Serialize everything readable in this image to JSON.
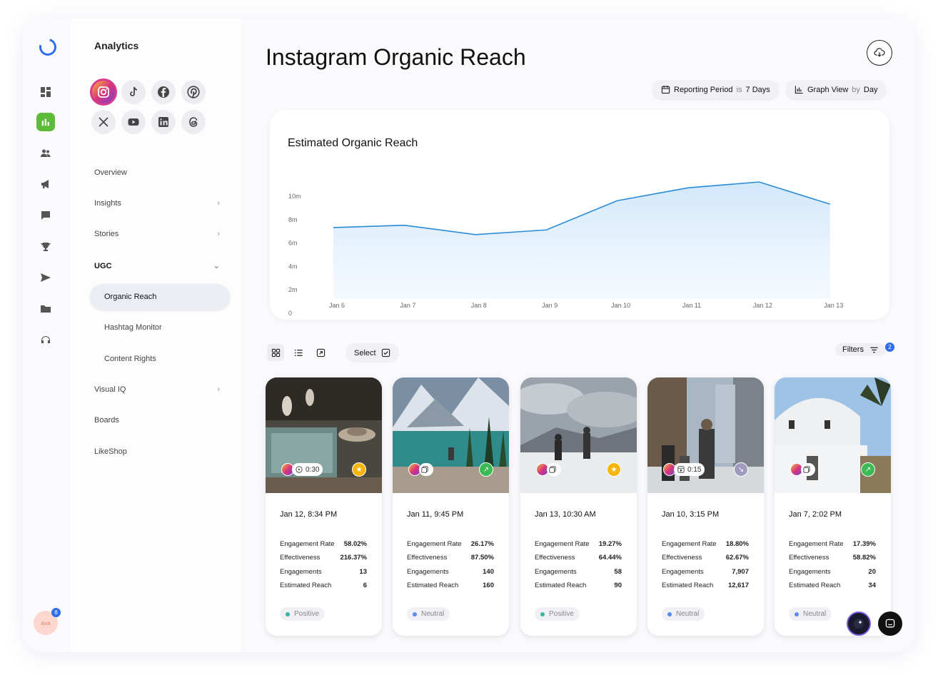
{
  "sidenav": {
    "title": "Analytics",
    "networks": [
      "instagram-icon",
      "tiktok-icon",
      "facebook-icon",
      "pinterest-icon",
      "x-icon",
      "youtube-icon",
      "linkedin-icon",
      "threads-icon"
    ],
    "items": [
      {
        "label": "Overview",
        "chevron": ""
      },
      {
        "label": "Insights",
        "chevron": "›"
      },
      {
        "label": "Stories",
        "chevron": "›"
      },
      {
        "label": "UGC",
        "chevron": "⌄"
      },
      {
        "label": "Organic Reach"
      },
      {
        "label": "Hashtag Monitor"
      },
      {
        "label": "Content Rights"
      },
      {
        "label": "Visual IQ",
        "chevron": "›"
      },
      {
        "label": "Boards"
      },
      {
        "label": "LikeShop"
      }
    ]
  },
  "rail": {
    "avatar_text": "ava",
    "avatar_badge": "8"
  },
  "header": {
    "title": "Instagram Organic Reach",
    "reporting": {
      "label": "Reporting Period",
      "joiner": "is",
      "value": "7 Days"
    },
    "graph": {
      "label": "Graph View",
      "joiner": "by",
      "value": "Day"
    }
  },
  "chart_data": {
    "type": "area",
    "title": "Estimated Organic Reach",
    "x": [
      "Jan 6",
      "Jan 7",
      "Jan 8",
      "Jan 9",
      "Jan 10",
      "Jan 11",
      "Jan 12",
      "Jan 13"
    ],
    "values": [
      6.1,
      6.3,
      5.5,
      5.9,
      8.4,
      9.5,
      10.0,
      8.1
    ],
    "y_ticks": [
      "0",
      "2m",
      "4m",
      "6m",
      "8m",
      "10m"
    ],
    "ylim": [
      0,
      16
    ],
    "grid": false,
    "color": "#2a8bd6"
  },
  "toolbar": {
    "select_label": "Select",
    "filters_label": "Filters",
    "filters_count": "2"
  },
  "metric_labels": [
    "Engagement Rate",
    "Effectiveness",
    "Engagements",
    "Estimated Reach"
  ],
  "posts": [
    {
      "date": "Jan 12, 8:34 PM",
      "duration": "0:30",
      "status": "star",
      "status_color": "#f5b50a",
      "metrics": [
        "58.02%",
        "216.37%",
        "13",
        "6"
      ],
      "sentiment": "Positive",
      "sentiment_color": "#3bb5a0"
    },
    {
      "date": "Jan 11, 9:45 PM",
      "duration": "",
      "status": "arrow-up",
      "status_color": "#3cba54",
      "metrics": [
        "26.17%",
        "87.50%",
        "140",
        "160"
      ],
      "sentiment": "Neutral",
      "sentiment_color": "#5b8de6"
    },
    {
      "date": "Jan 13, 10:30 AM",
      "duration": "",
      "status": "star",
      "status_color": "#f5b50a",
      "metrics": [
        "19.27%",
        "64.44%",
        "58",
        "90"
      ],
      "sentiment": "Positive",
      "sentiment_color": "#3bb5a0"
    },
    {
      "date": "Jan 10, 3:15 PM",
      "duration": "0:15",
      "status": "arrow-down",
      "status_color": "#a09abc",
      "metrics": [
        "18.80%",
        "62.67%",
        "7,907",
        "12,617"
      ],
      "sentiment": "Neutral",
      "sentiment_color": "#5b8de6"
    },
    {
      "date": "Jan 7, 2:02 PM",
      "duration": "",
      "status": "arrow-up",
      "status_color": "#3cba54",
      "metrics": [
        "17.39%",
        "58.82%",
        "20",
        "34"
      ],
      "sentiment": "Neutral",
      "sentiment_color": "#5b8de6"
    }
  ]
}
